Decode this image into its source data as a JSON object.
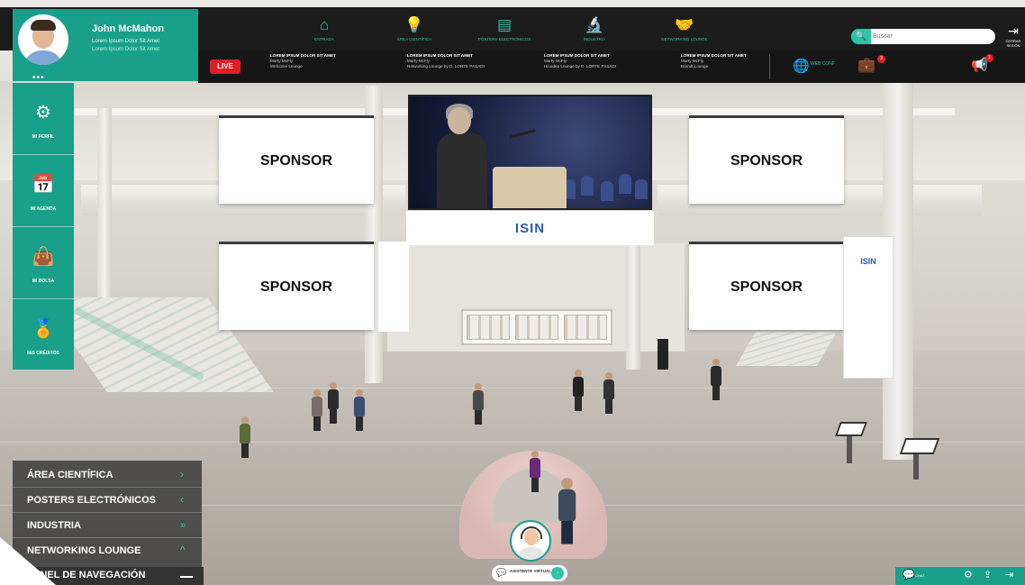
{
  "user": {
    "name": "John McMahon",
    "subtitle1": "Lorem Ipsum Dolor Sit Amet",
    "subtitle2": "Lorem Ipsum Dolor Sit Amet",
    "dots": "•••"
  },
  "top_nav": [
    {
      "label": "ENTRADA",
      "icon": "home-icon",
      "glyph": "⌂"
    },
    {
      "label": "ÁREA CIENTÍFICA",
      "icon": "lightbulb-icon",
      "glyph": "💡"
    },
    {
      "label": "PÓSTERS ELECTRÓNICOS",
      "icon": "poster-icon",
      "glyph": "▤"
    },
    {
      "label": "INDUSTRIA",
      "icon": "microscope-icon",
      "glyph": "🔬"
    },
    {
      "label": "NETWORKING LOUNGE",
      "icon": "handshake-icon",
      "glyph": "🤝"
    }
  ],
  "search": {
    "placeholder": "Buscar"
  },
  "logout": {
    "label": "CERRAR SESIÓN"
  },
  "live": {
    "badge": "LIVE",
    "sessions": [
      {
        "title": "LOREM IPSUM DOLOR SIT AMET",
        "speaker": "Marty McFly",
        "room": "Welcome Lounge"
      },
      {
        "title": "LOREM IPSUM DOLOR SIT AMET",
        "speaker": "Marty McFly",
        "room": "Networking Lounge by D. LORTE PASADI"
      },
      {
        "title": "LOREM IPSUM DOLOR SIT AMET",
        "speaker": "Marty McFly",
        "room": "Hinodea Lounge by D. LORTE PASADI"
      },
      {
        "title": "LOREM IPSUM DOLOR SIT AMET",
        "speaker": "Marty McFly",
        "room": "Brendt Lounge"
      }
    ],
    "globe_label": "WEB CONF",
    "bag_count": "3",
    "mega_count": "1"
  },
  "sidebar": [
    {
      "label": "MI PERFIL",
      "icon": "profile-icon",
      "glyph": "⚙"
    },
    {
      "label": "MI AGENDA",
      "icon": "calendar-icon",
      "glyph": "📅"
    },
    {
      "label": "MI BOLSA",
      "icon": "bag-icon",
      "glyph": "👜"
    },
    {
      "label": "MIS CRÉDITOS",
      "icon": "credits-icon",
      "glyph": "🏅"
    }
  ],
  "sponsors": [
    "SPONSOR",
    "SPONSOR",
    "SPONSOR",
    "SPONSOR"
  ],
  "logo": "ISIN",
  "nav_panel": {
    "items": [
      {
        "label": "ÁREA CIENTÍFICA",
        "arrow": "›"
      },
      {
        "label": "POSTERS ELECTRÓNICOS",
        "arrow": "‹"
      },
      {
        "label": "INDUSTRIA",
        "arrow": "»"
      },
      {
        "label": "NETWORKING LOUNGE",
        "arrow": "^"
      }
    ],
    "title": "PANEL DE NAVEGACIÓN"
  },
  "assistant": {
    "label": "ASISTENTE VIRTUAL"
  },
  "bottom_right": {
    "chat_label": "CHAT"
  },
  "colors": {
    "accent": "#18a08a",
    "accent_light": "#2ec4a6",
    "live": "#e01e26"
  }
}
